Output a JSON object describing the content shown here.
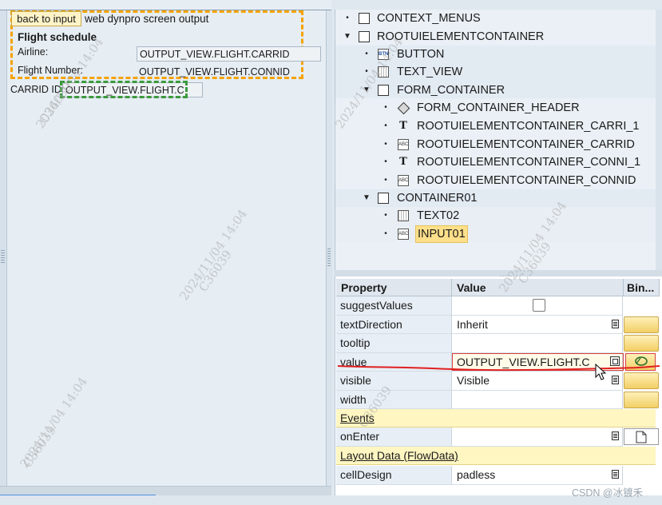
{
  "preview": {
    "back_button": "back to input",
    "screen_title": "web dynpro screen output",
    "heading": "Flight schedule",
    "airline_label": "Airline:",
    "airline_value": "OUTPUT_VIEW.FLIGHT.CARRID",
    "flight_number_label": "Flight Number:",
    "flight_number_value": "OUTPUT_VIEW.FLIGHT.CONNID",
    "carrid_label": "CARRID ID",
    "carrid_input": "OUTPUT_VIEW.FLIGHT.C"
  },
  "tree": {
    "items": [
      {
        "label": "CONTEXT_MENUS",
        "icon": "box-icon",
        "toggle": "•"
      },
      {
        "label": "ROOTUIELEMENTCONTAINER",
        "icon": "box-icon",
        "toggle": "▼"
      },
      {
        "label": "BUTTON",
        "icon": "button-icon",
        "toggle": "•"
      },
      {
        "label": "TEXT_VIEW",
        "icon": "grid-icon",
        "toggle": "•"
      },
      {
        "label": "FORM_CONTAINER",
        "icon": "box-icon",
        "toggle": "▼"
      },
      {
        "label": "FORM_CONTAINER_HEADER",
        "icon": "diamond-icon",
        "toggle": "•"
      },
      {
        "label": "ROOTUIELEMENTCONTAINER_CARRI_1",
        "icon": "text-T-icon",
        "toggle": "•"
      },
      {
        "label": "ROOTUIELEMENTCONTAINER_CARRID",
        "icon": "abc-input-icon",
        "toggle": "•"
      },
      {
        "label": "ROOTUIELEMENTCONTAINER_CONNI_1",
        "icon": "text-T-icon",
        "toggle": "•"
      },
      {
        "label": "ROOTUIELEMENTCONTAINER_CONNID",
        "icon": "abc-input-icon",
        "toggle": "•"
      },
      {
        "label": "CONTAINER01",
        "icon": "box-icon",
        "toggle": "▼"
      },
      {
        "label": "TEXT02",
        "icon": "grid-icon",
        "toggle": "•"
      },
      {
        "label": "INPUT01",
        "icon": "abc-input-icon",
        "toggle": "•",
        "selected": true
      }
    ],
    "icon_glyphs": {
      "button": "BTN",
      "abc": "ABC",
      "text": "T"
    }
  },
  "properties": {
    "headers": {
      "property": "Property",
      "value": "Value",
      "binding": "Bin..."
    },
    "rows": [
      {
        "name": "suggestValues",
        "value": "",
        "control": "checkbox"
      },
      {
        "name": "textDirection",
        "value": "Inherit",
        "control": "dropdown"
      },
      {
        "name": "tooltip",
        "value": "",
        "control": "text"
      },
      {
        "name": "value",
        "value": "OUTPUT_VIEW.FLIGHT.C",
        "control": "binding",
        "highlighted": true
      },
      {
        "name": "visible",
        "value": "Visible",
        "control": "dropdown"
      },
      {
        "name": "width",
        "value": "",
        "control": "text"
      }
    ],
    "events_section": "Events",
    "event_rows": [
      {
        "name": "onEnter",
        "value": "",
        "control": "dropdown"
      }
    ],
    "layout_section": "Layout Data (FlowData)",
    "layout_rows": [
      {
        "name": "cellDesign",
        "value": "padless",
        "control": "dropdown"
      }
    ]
  },
  "watermark": {
    "date": "2024/11/04 14:04",
    "code": "C36039"
  },
  "credit": "CSDN @冰镀禾",
  "colors": {
    "orange_highlight": "#f4a300",
    "green_highlight": "#3c9a3c",
    "red_annotation": "#e02020",
    "gold_button": "#f2cf66"
  }
}
